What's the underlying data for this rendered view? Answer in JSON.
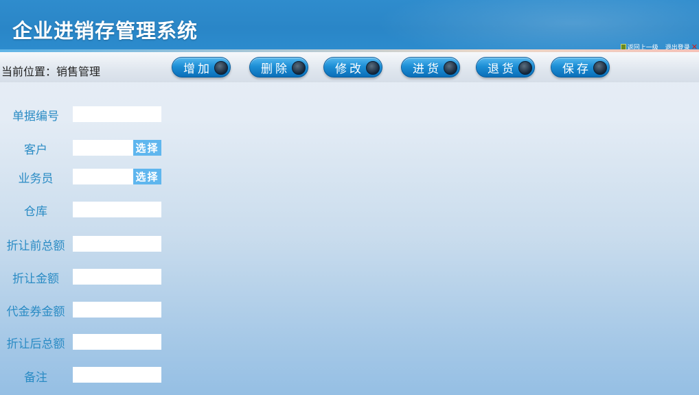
{
  "app": {
    "title": "企业进销存管理系统"
  },
  "top_links": {
    "back": "返回上一级",
    "logout": "退出登录"
  },
  "breadcrumb": "当前位置：销售管理",
  "toolbar": {
    "add": "增加",
    "delete": "删除",
    "modify": "修改",
    "stock_in": "进货",
    "return": "退货",
    "save": "保存"
  },
  "form": {
    "order_no": {
      "label": "单据编号",
      "value": ""
    },
    "customer": {
      "label": "客户",
      "value": "",
      "pick": "选择"
    },
    "salesperson": {
      "label": "业务员",
      "value": "",
      "pick": "选择"
    },
    "warehouse": {
      "label": "仓库",
      "value": ""
    },
    "total_before_discount": {
      "label": "折让前总额",
      "value": ""
    },
    "discount_amount": {
      "label": "折让金额",
      "value": ""
    },
    "voucher_amount": {
      "label": "代金券金额",
      "value": ""
    },
    "total_after_discount": {
      "label": "折让后总额",
      "value": ""
    },
    "remark": {
      "label": "备注",
      "value": ""
    }
  },
  "colors": {
    "header": "#2a86c7",
    "label": "#2a8bc4",
    "button": "#1d8fd6",
    "pick": "#5fb6ee"
  }
}
